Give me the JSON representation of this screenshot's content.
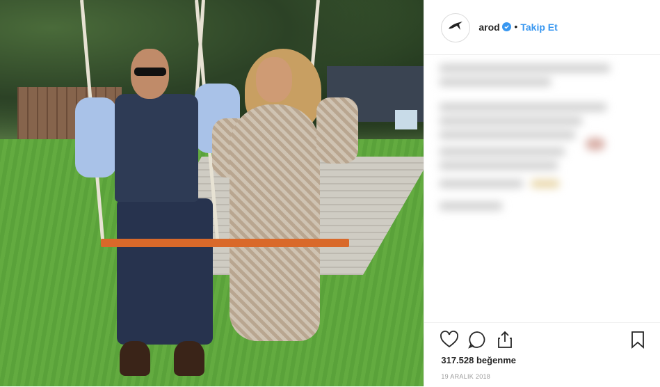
{
  "profile": {
    "username": "arod",
    "verified": true,
    "follow_label": "Takip Et",
    "separator": "•"
  },
  "post": {
    "likes_text": "317.528 beğenme",
    "date_text": "19 ARALIK 2018"
  },
  "icons": {
    "like": "heart-icon",
    "comment": "comment-icon",
    "share": "share-icon",
    "save": "bookmark-icon",
    "verified": "verified-badge-icon",
    "avatar": "arod-logo-icon"
  },
  "colors": {
    "accent": "#3897f0",
    "text": "#262626",
    "muted": "#999999",
    "border": "#efefef"
  }
}
